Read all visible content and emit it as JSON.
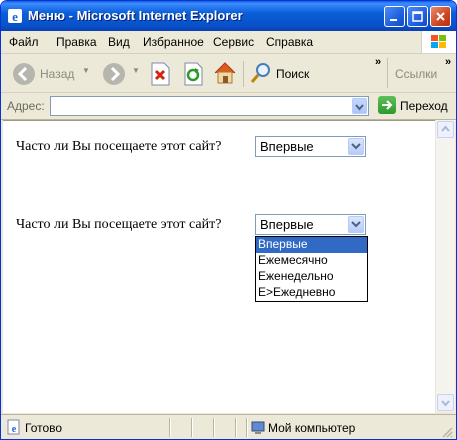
{
  "window": {
    "title": "Меню - Microsoft Internet Explorer"
  },
  "menu": [
    "Файл",
    "Правка",
    "Вид",
    "Избранное",
    "Сервис",
    "Справка"
  ],
  "toolbar": {
    "back_label": "Назад",
    "search_label": "Поиск",
    "tools_label": "Ссылки"
  },
  "address": {
    "label": "Адрес:",
    "value": "",
    "go_label": "Переход"
  },
  "page": {
    "question1": "Часто ли Вы посещаете этот сайт?",
    "select1_value": "Впервые",
    "question2": "Часто ли Вы посещаете этот сайт?",
    "select2_value": "Впервые",
    "options": [
      "Впервые",
      "Ежемесячно",
      "Еженедельно",
      "E>Ежедневно"
    ],
    "highlighted_option": "Впервые"
  },
  "status": {
    "text": "Готово",
    "zone": "Мой компьютер"
  },
  "colors": {
    "titlebar": "#0a5fd8",
    "selection": "#316ac5",
    "chrome": "#ece9d8"
  }
}
